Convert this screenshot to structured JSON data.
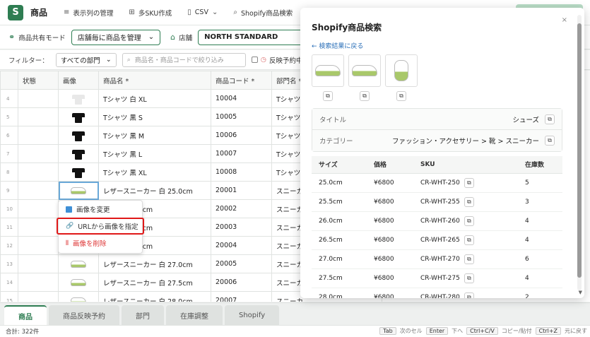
{
  "topbar": {
    "logo": "S",
    "title": "商品",
    "items": [
      {
        "icon": "list-icon",
        "glyph": "≡",
        "label": "表示列の管理"
      },
      {
        "icon": "grid-icon",
        "glyph": "⊞",
        "label": "多SKU作成"
      },
      {
        "icon": "file-icon",
        "glyph": "▯",
        "label": "CSV",
        "caret": "⌄"
      },
      {
        "icon": "search-icon",
        "glyph": "⌕",
        "label": "Shopify商品検索"
      }
    ]
  },
  "modebar": {
    "mode_label": "商品共有モード",
    "mode_value": "店舗毎に商品を管理",
    "store_label": "店舗",
    "store_value": "NORTH STANDARD"
  },
  "filterbar": {
    "label": "フィルター：",
    "dept_value": "すべての部門",
    "search_placeholder": "商品名・商品コードで絞り込み",
    "checkbox_label": "反映予約中のみ"
  },
  "grid": {
    "headers": [
      "状態",
      "画像",
      "商品名 *",
      "商品コード *",
      "部門名 *"
    ],
    "rows": [
      {
        "n": "4",
        "img": "tshirt-white",
        "name": "Tシャツ 白 XL",
        "code": "10004",
        "dept": "Tシャツ"
      },
      {
        "n": "5",
        "img": "tshirt-black",
        "name": "Tシャツ 黒 S",
        "code": "10005",
        "dept": "Tシャツ"
      },
      {
        "n": "6",
        "img": "tshirt-black",
        "name": "Tシャツ 黒 M",
        "code": "10006",
        "dept": "Tシャツ"
      },
      {
        "n": "7",
        "img": "tshirt-black",
        "name": "Tシャツ 黒 L",
        "code": "10007",
        "dept": "Tシャツ"
      },
      {
        "n": "8",
        "img": "tshirt-black",
        "name": "Tシャツ 黒 XL",
        "code": "10008",
        "dept": "Tシャツ"
      },
      {
        "n": "9",
        "img": "shoe",
        "name": "レザースニーカー 白 25.0cm",
        "code": "20001",
        "dept": "スニーカ"
      },
      {
        "n": "10",
        "img": "",
        "name": "カー 白 25.5cm",
        "code": "20002",
        "dept": "スニーカ"
      },
      {
        "n": "11",
        "img": "",
        "name": "カー 白 26.0cm",
        "code": "20003",
        "dept": "スニーカ"
      },
      {
        "n": "12",
        "img": "",
        "name": "カー 白 26.5cm",
        "code": "20004",
        "dept": "スニーカ"
      },
      {
        "n": "13",
        "img": "shoe",
        "name": "レザースニーカー 白 27.0cm",
        "code": "20005",
        "dept": "スニーカ"
      },
      {
        "n": "14",
        "img": "shoe",
        "name": "レザースニーカー 白 27.5cm",
        "code": "20006",
        "dept": "スニーカ"
      },
      {
        "n": "15",
        "img": "shoe",
        "name": "レザースニーカー 白 28.0cm",
        "code": "20007",
        "dept": "スニーカ"
      }
    ]
  },
  "context_menu": {
    "items": [
      {
        "label": "画像を変更",
        "icon": "image-icon"
      },
      {
        "label": "URLから画像を指定",
        "icon": "link-icon",
        "glyph": "🔗"
      },
      {
        "label": "画像を削除",
        "icon": "trash-icon",
        "glyph": "⫴"
      }
    ]
  },
  "tabs": [
    "商品",
    "商品反映予約",
    "部門",
    "在庫調整",
    "Shopify"
  ],
  "status": {
    "total": "合計: 322件",
    "hints": [
      {
        "key": "Tab",
        "text": "次のセル"
      },
      {
        "key": "Enter",
        "text": "下へ"
      },
      {
        "key": "Ctrl+C/V",
        "text": "コピー/貼付"
      },
      {
        "key": "Ctrl+Z",
        "text": "元に戻す"
      }
    ]
  },
  "panel": {
    "title": "Shopify商品検索",
    "close": "×",
    "back_link": "← 検索結果に戻る",
    "copy_glyph": "⧉",
    "title_label": "タイトル",
    "title_value": "シューズ",
    "category_label": "カテゴリー",
    "category_value": "ファッション・アクセサリー > 靴 > スニーカー",
    "variant_headers": [
      "サイズ",
      "価格",
      "SKU",
      "在庫数"
    ],
    "variants": [
      {
        "size": "25.0cm",
        "price": "¥6800",
        "sku": "CR-WHT-250",
        "stock": "5"
      },
      {
        "size": "25.5cm",
        "price": "¥6800",
        "sku": "CR-WHT-255",
        "stock": "3"
      },
      {
        "size": "26.0cm",
        "price": "¥6800",
        "sku": "CR-WHT-260",
        "stock": "4"
      },
      {
        "size": "26.5cm",
        "price": "¥6800",
        "sku": "CR-WHT-265",
        "stock": "4"
      },
      {
        "size": "27.0cm",
        "price": "¥6800",
        "sku": "CR-WHT-270",
        "stock": "6"
      },
      {
        "size": "27.5cm",
        "price": "¥6800",
        "sku": "CR-WHT-275",
        "stock": "4"
      },
      {
        "size": "28.0cm",
        "price": "¥6800",
        "sku": "CR-WHT-280",
        "stock": "2"
      }
    ]
  },
  "colors": {
    "accent": "#2e7d52",
    "highlight": "#e01818",
    "link": "#2a6fb8"
  }
}
